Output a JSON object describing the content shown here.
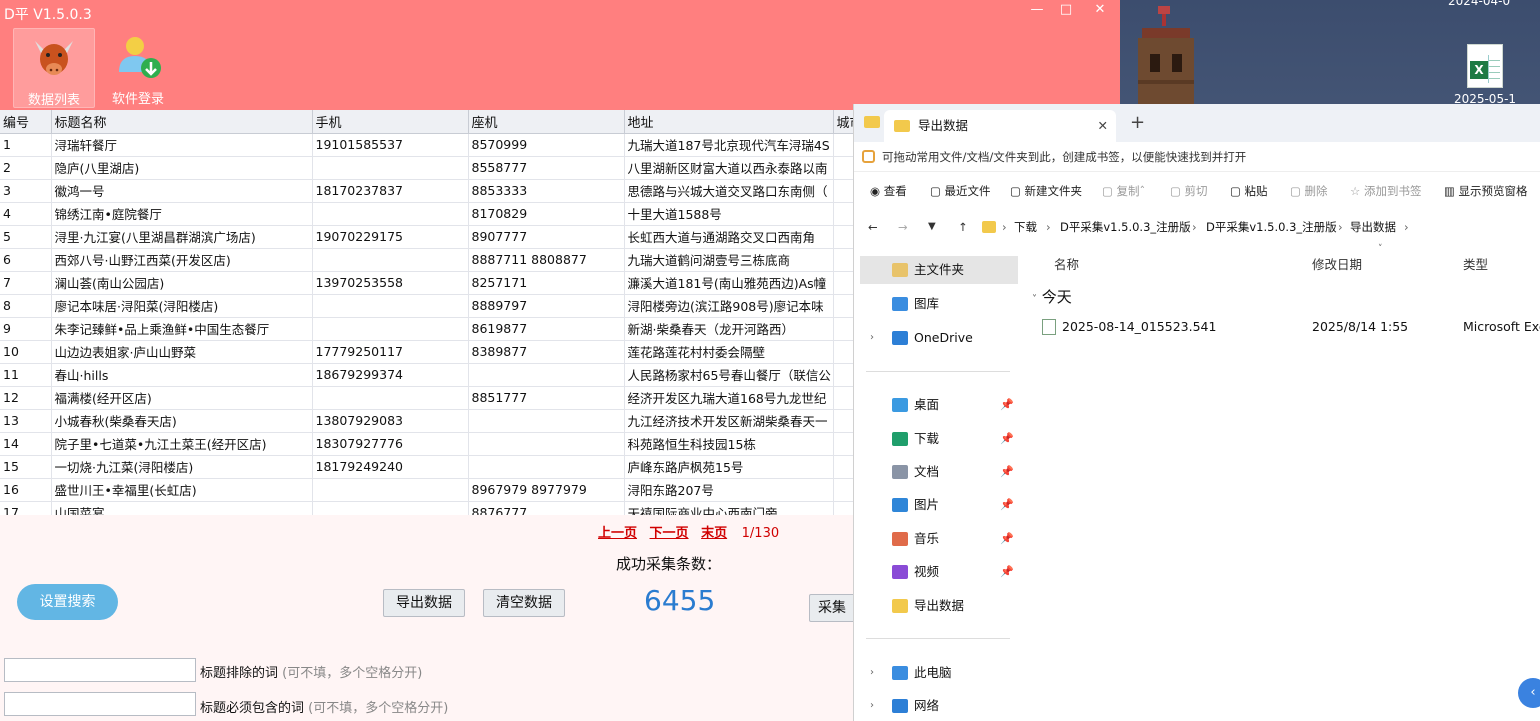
{
  "desktop": {
    "clock": "2024-04-0",
    "file_label": "2025-05-1"
  },
  "app": {
    "title": "D平 V1.5.0.3",
    "window_controls": [
      "—",
      "□",
      "✕"
    ],
    "toolbar": {
      "data_list": "数据列表",
      "software_login": "软件登录"
    },
    "table": {
      "columns": [
        "编号",
        "标题名称",
        "手机",
        "座机",
        "地址",
        "城市"
      ],
      "rows": [
        [
          "1",
          "浔瑞轩餐厅",
          "19101585537",
          "8570999",
          "九瑞大道187号北京现代汽车浔瑞4S"
        ],
        [
          "2",
          "隐庐(八里湖店)",
          "",
          "8558777",
          "八里湖新区财富大道以西永泰路以南"
        ],
        [
          "3",
          "徽鸿一号",
          "18170237837",
          "8853333",
          "思德路与兴城大道交叉路口东南侧（"
        ],
        [
          "4",
          "锦绣江南•庭院餐厅",
          "",
          "8170829",
          "十里大道1588号"
        ],
        [
          "5",
          "浔里·九江宴(八里湖昌群湖滨广场店)",
          "19070229175",
          "8907777",
          "长虹西大道与通湖路交叉口西南角"
        ],
        [
          "6",
          "西郊八号·山野江西菜(开发区店)",
          "",
          "8887711 8808877",
          "九瑞大道鹤问湖壹号三栋底商"
        ],
        [
          "7",
          "澜山荟(南山公园店)",
          "13970253558",
          "8257171",
          "濂溪大道181号(南山雅苑西边)As幢"
        ],
        [
          "8",
          "廖记本味居·浔阳菜(浔阳楼店)",
          "",
          "8889797",
          "浔阳楼旁边(滨江路908号)廖记本味"
        ],
        [
          "9",
          "朱李记臻鲜•品上乘渔鲜•中国生态餐厅",
          "",
          "8619877",
          "新湖·柴桑春天（龙开河路西）"
        ],
        [
          "10",
          "山边边表姐家·庐山山野菜",
          "17779250117",
          "8389877",
          "莲花路莲花村村委会隔壁"
        ],
        [
          "11",
          "春山·hills",
          "18679299374",
          "",
          "人民路杨家村65号春山餐厅（联信公"
        ],
        [
          "12",
          "福满楼(经开区店)",
          "",
          "8851777",
          "经济开发区九瑞大道168号九龙世纪"
        ],
        [
          "13",
          "小城春秋(柴桑春天店)",
          "13807929083",
          "",
          "九江经济技术开发区新湖柴桑春天一"
        ],
        [
          "14",
          "院子里•七道菜•九江土菜王(经开区店)",
          "18307927776",
          "",
          "科苑路恒生科技园15栋"
        ],
        [
          "15",
          "一切烧·九江菜(浔阳楼店)",
          "18179249240",
          "",
          "庐峰东路庐枫苑15号"
        ],
        [
          "16",
          "盛世川王•幸福里(长虹店)",
          "",
          "8967979 8977979",
          "浔阳东路207号"
        ],
        [
          "17",
          "山国菜宴",
          "",
          "8876777",
          "天禧国际商业中心西南门旁"
        ]
      ]
    },
    "pager": {
      "prev": "上一页",
      "next": "下一页",
      "last": "末页",
      "page": "1/130"
    },
    "count_label": "成功采集条数：",
    "count_value": "6455",
    "buttons": {
      "search_settings": "设置搜索",
      "export": "导出数据",
      "clear": "清空数据",
      "collect": "采集"
    },
    "filters": {
      "exclude_label": "标题排除的词",
      "exclude_hint": "(可不填，多个空格分开)",
      "include_label": "标题必须包含的词",
      "include_hint": "(可不填，多个空格分开)"
    }
  },
  "explorer": {
    "tab_title": "导出数据",
    "new_tab": "+",
    "hint": "可拖动常用文件/文档/文件夹到此，创建成书签，以便能快速找到并打开",
    "commands": [
      "查看",
      "最近文件",
      "新建文件夹",
      "复制",
      "剪切",
      "粘贴",
      "删除",
      "添加到书签",
      "显示预览窗格"
    ],
    "breadcrumb": [
      "下载",
      "D平采集v1.5.0.3_注册版",
      "D平采集v1.5.0.3_注册版",
      "导出数据"
    ],
    "nav": {
      "home": "主文件夹",
      "gallery": "图库",
      "onedrive": "OneDrive",
      "desktop": "桌面",
      "downloads": "下载",
      "documents": "文档",
      "pictures": "图片",
      "music": "音乐",
      "videos": "视频",
      "export_folder": "导出数据",
      "this_pc": "此电脑",
      "network": "网络"
    },
    "columns": {
      "name": "名称",
      "modified": "修改日期",
      "type": "类型"
    },
    "group": "今天",
    "file": {
      "name": "2025-08-14_015523.541",
      "modified": "2025/8/14 1:55",
      "type": "Microsoft Exc"
    }
  }
}
